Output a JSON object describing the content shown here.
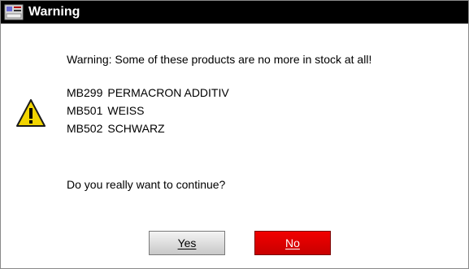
{
  "dialog": {
    "title": "Warning",
    "message": "Warning: Some of these products are no more in stock at all!",
    "products": [
      {
        "code": "MB299",
        "name": "PERMACRON ADDITIV"
      },
      {
        "code": "MB501",
        "name": "WEISS"
      },
      {
        "code": "MB502",
        "name": "SCHWARZ"
      }
    ],
    "question": "Do you really want to continue?",
    "buttons": {
      "yes": "Yes",
      "no": "No"
    }
  },
  "icons": {
    "title_icon": "app-icon",
    "message_icon": "warning-icon"
  },
  "colors": {
    "titlebar": "#000000",
    "no_button": "#e00000",
    "yes_button": "#d9d9d9",
    "warning_icon": "#f2d500"
  }
}
